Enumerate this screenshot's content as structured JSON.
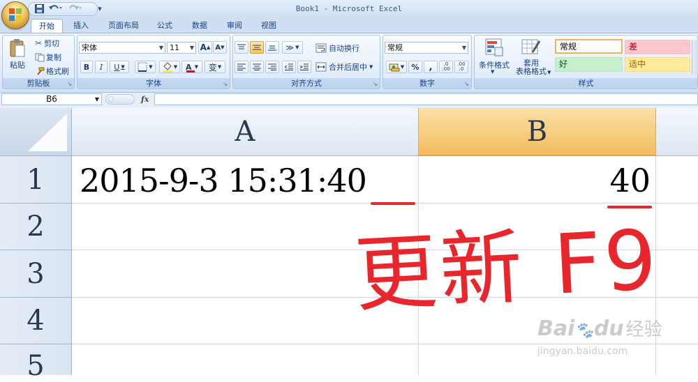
{
  "window": {
    "title": "Book1 - Microsoft Excel"
  },
  "quick_access": {
    "undo_icon": "undo-icon",
    "redo_icon": "redo-icon",
    "save_icon": "save-icon",
    "customize_glyph": "▾"
  },
  "tabs": [
    {
      "label": "开始",
      "active": true
    },
    {
      "label": "插入"
    },
    {
      "label": "页面布局"
    },
    {
      "label": "公式"
    },
    {
      "label": "数据"
    },
    {
      "label": "审阅"
    },
    {
      "label": "视图"
    }
  ],
  "ribbon": {
    "clipboard": {
      "label": "剪贴板",
      "paste": "粘贴",
      "cut": "剪切",
      "copy": "复制",
      "format_painter": "格式刷"
    },
    "font": {
      "label": "字体",
      "name": "宋体",
      "size": "11",
      "grow": "A",
      "shrink": "A",
      "bold": "B",
      "italic": "I",
      "underline": "U",
      "wen": "变",
      "font_color_letter": "A"
    },
    "alignment": {
      "label": "对齐方式",
      "wrap_text": "自动换行",
      "merge_center": "合并后居中"
    },
    "number": {
      "label": "数字",
      "format": "常规",
      "percent": "%",
      "comma": ",",
      "inc_decimal": ".0 .00",
      "dec_decimal": ".00 .0"
    },
    "styles": {
      "label": "样式",
      "conditional": "条件格式",
      "table_format_1": "套用",
      "table_format_2": "表格格式",
      "cells": [
        {
          "text": "常规",
          "bg": "#ffffff",
          "fg": "#000000"
        },
        {
          "text": "差",
          "bg": "#ffc7ce",
          "fg": "#9c0006"
        },
        {
          "text": "好",
          "bg": "#c6efce",
          "fg": "#006100"
        },
        {
          "text": "适中",
          "bg": "#ffeb9c",
          "fg": "#9c6500"
        }
      ]
    }
  },
  "formula_bar": {
    "name_box": "B6",
    "fx": "fx",
    "value": ""
  },
  "sheet": {
    "columns": [
      "A",
      "B"
    ],
    "rows": [
      "1",
      "2",
      "3",
      "4",
      "5"
    ],
    "cells": {
      "A1": "2015-9-3 15:31:40",
      "B1": "40"
    }
  },
  "annotation": {
    "text": "更新 F9",
    "color": "#e8262b"
  },
  "watermark": {
    "logo": "Bai",
    "logo2": "du",
    "brand": "经验",
    "url": "jingyan.baidu.com"
  }
}
